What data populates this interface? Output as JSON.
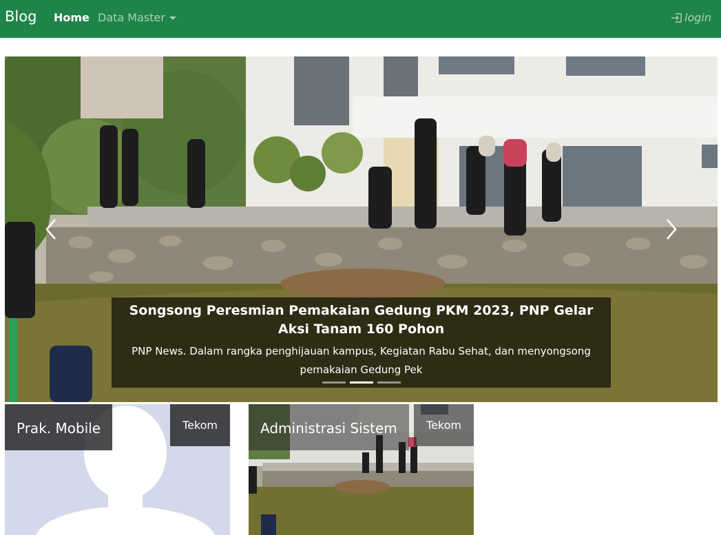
{
  "navbar": {
    "brand": "Blog",
    "home": "Home",
    "data_master": "Data Master",
    "login": "login"
  },
  "carousel": {
    "slides": 3,
    "active_slide": 2,
    "caption_title": "Songsong Peresmian Pemakaian Gedung PKM 2023, PNP Gelar Aksi Tanam 160 Pohon",
    "caption_text": "PNP News. Dalam rangka penghijauan kampus, Kegiatan Rabu Sehat, dan menyongsong pemakaian Gedung Pek",
    "prev_icon": "chevron-left-icon",
    "next_icon": "chevron-right-icon"
  },
  "cards": [
    {
      "title": "Prak. Mobile",
      "badge": "Tekom",
      "image": "default-avatar"
    },
    {
      "title": "Administrasi Sistem",
      "badge": "Tekom",
      "image": "tree-planting-photo"
    }
  ],
  "colors": {
    "navbar": "#1e8449",
    "caption_bg": "rgba(0,0,0,0.62)",
    "card_title_bg": "#232323"
  }
}
